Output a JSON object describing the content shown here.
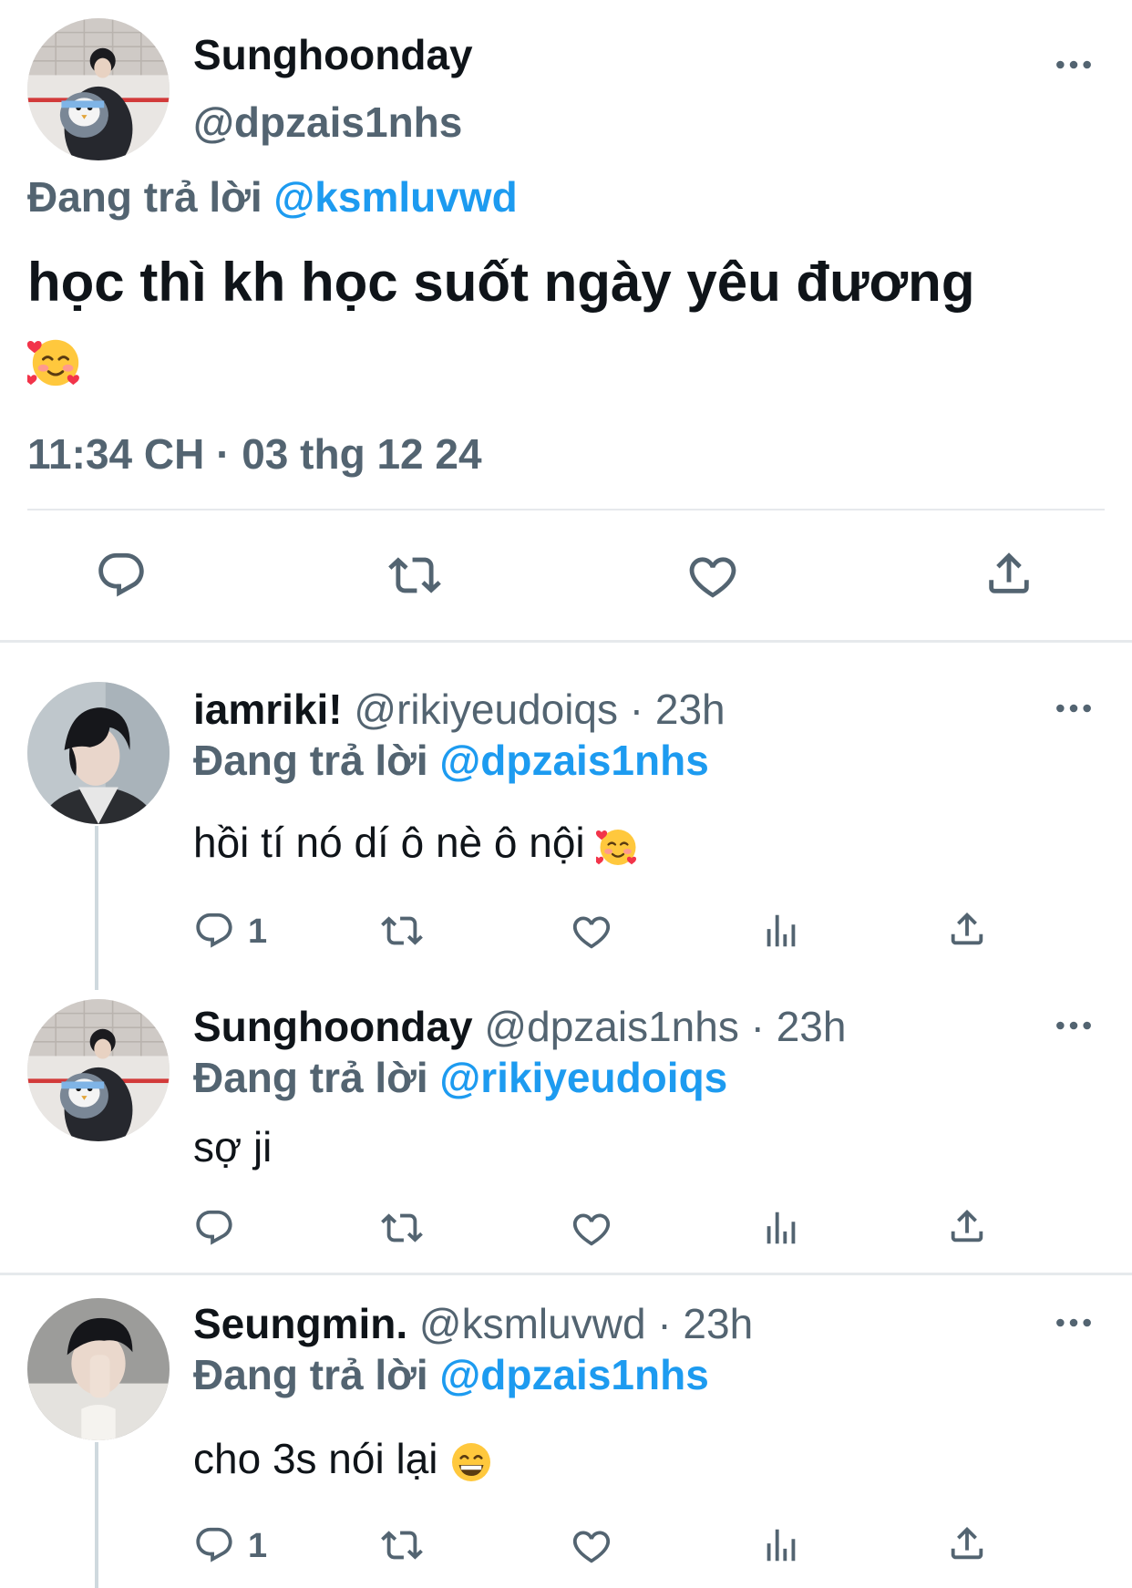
{
  "main_tweet": {
    "display_name": "Sunghoonday",
    "handle": "@dpzais1nhs",
    "reply_prefix": "Đang trả lời",
    "reply_to": "@ksmluvwd",
    "text": "học thì kh học suốt ngày yêu đương",
    "emoji": "smiling-face-with-hearts",
    "timestamp": "11:34 CH · 03 thg 12 24",
    "actions": [
      "reply-icon",
      "retweet-icon",
      "like-icon",
      "share-icon"
    ]
  },
  "replies": [
    {
      "display_name": "iamriki!",
      "handle": "@rikiyeudoiqs",
      "time": "· 23h",
      "reply_prefix": "Đang trả lời",
      "reply_to": "@dpzais1nhs",
      "text": "hồi tí nó dí ô nè ô nội",
      "emoji": "smiling-face-with-hearts",
      "reply_count": "1"
    },
    {
      "display_name": "Sunghoonday",
      "handle": "@dpzais1nhs",
      "time": "· 23h",
      "reply_prefix": "Đang trả lời",
      "reply_to": "@rikiyeudoiqs",
      "text": "sợ ji",
      "reply_count": ""
    },
    {
      "display_name": "Seungmin.",
      "handle": "@ksmluvwd",
      "time": "· 23h",
      "reply_prefix": "Đang trả lời",
      "reply_to": "@dpzais1nhs",
      "text": "cho 3s nói lại",
      "emoji": "grinning-face",
      "reply_count": "1"
    }
  ],
  "colors": {
    "text": "#0f1419",
    "secondary": "#536471",
    "accent": "#1d9bf0",
    "divider": "#e6e9ec"
  }
}
